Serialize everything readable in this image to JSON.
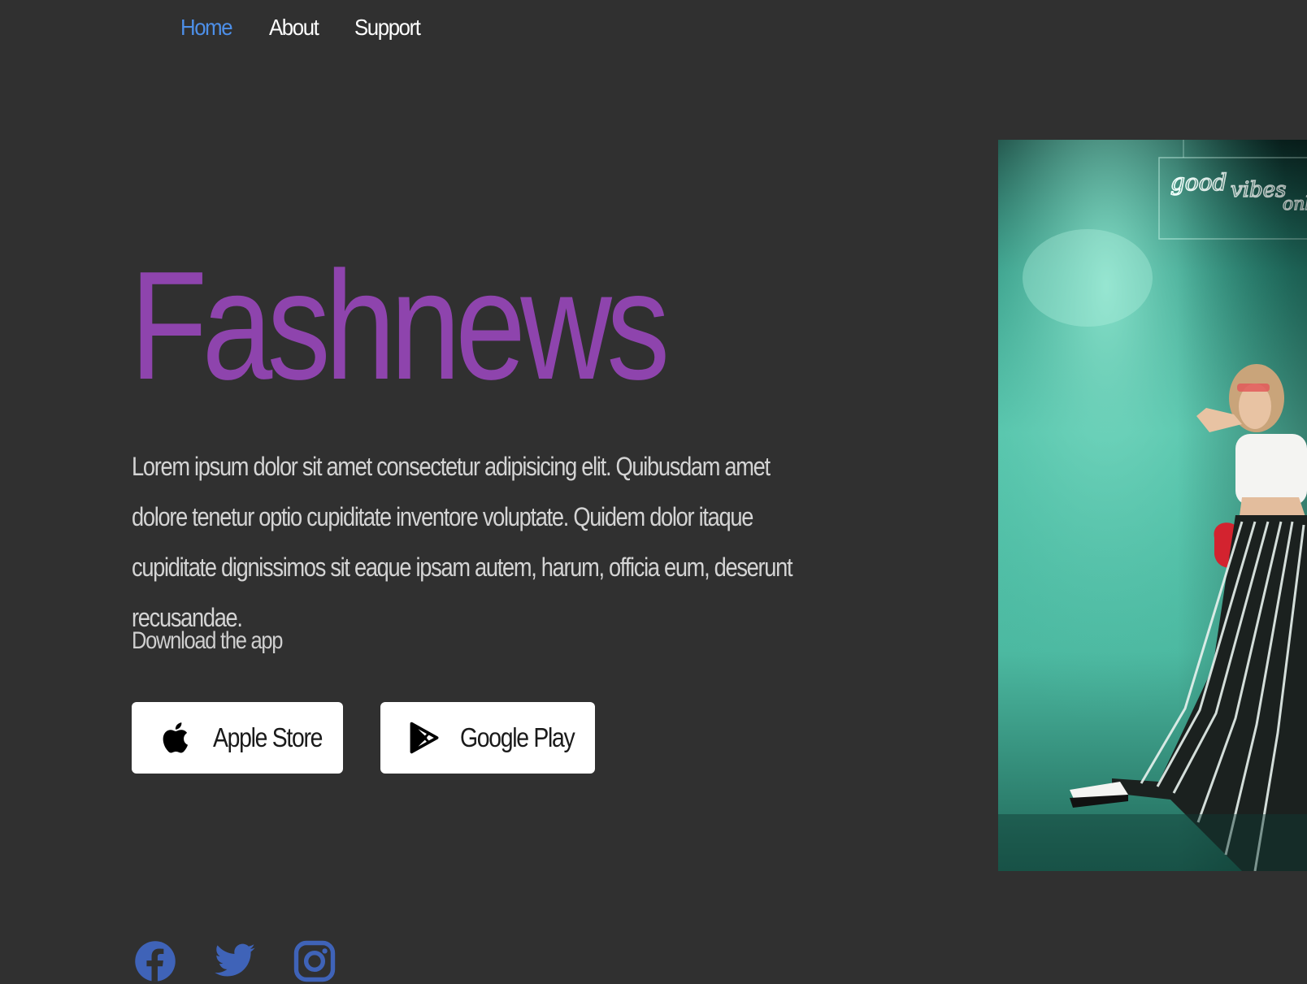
{
  "nav": {
    "items": [
      {
        "label": "Home",
        "active": true
      },
      {
        "label": "About",
        "active": false
      },
      {
        "label": "Support",
        "active": false
      }
    ]
  },
  "hero": {
    "title": "Fashnews",
    "description": "Lorem ipsum dolor sit amet consectetur adipisicing elit. Quibusdam amet dolore tenetur optio cupiditate inventore voluptate. Quidem dolor itaque cupiditate dignissimos sit eaque ipsam autem, harum, officia eum, deserunt recusandae.",
    "download_label": "Download the app",
    "neon_sign": "good vibes only"
  },
  "buttons": {
    "apple": {
      "label": "Apple Store",
      "icon": "apple-icon"
    },
    "google": {
      "label": "Google Play",
      "icon": "google-play-icon"
    }
  },
  "social": [
    {
      "icon": "facebook-icon"
    },
    {
      "icon": "twitter-icon"
    },
    {
      "icon": "instagram-icon"
    }
  ],
  "colors": {
    "background": "#303030",
    "title": "#8e44ad",
    "nav_active": "#4d8fe8",
    "social": "#3f63b8",
    "image_teal": "#4cb9a1"
  }
}
